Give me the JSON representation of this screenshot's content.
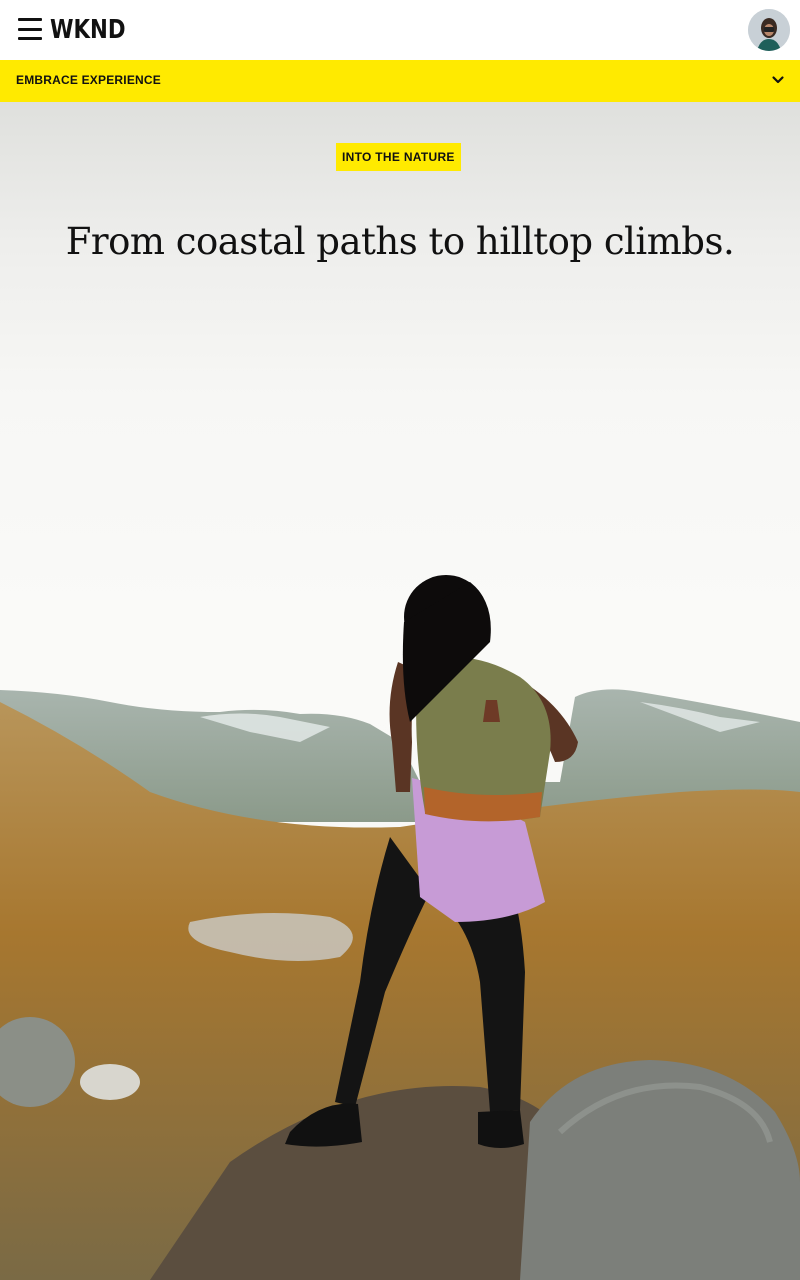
{
  "header": {
    "logo": "WKND",
    "menu_icon": "hamburger-menu-icon",
    "avatar_icon": "user-avatar"
  },
  "subnav": {
    "label": "EMBRACE EXPERIENCE",
    "icon": "chevron-down-icon"
  },
  "hero": {
    "tag": "INTO THE NATURE",
    "headline": "From coastal paths to hilltop climbs.",
    "image": "hiker-with-backpack-mountain-landscape"
  },
  "colors": {
    "accent_yellow": "#ffea00",
    "text": "#111111",
    "background": "#ffffff"
  }
}
